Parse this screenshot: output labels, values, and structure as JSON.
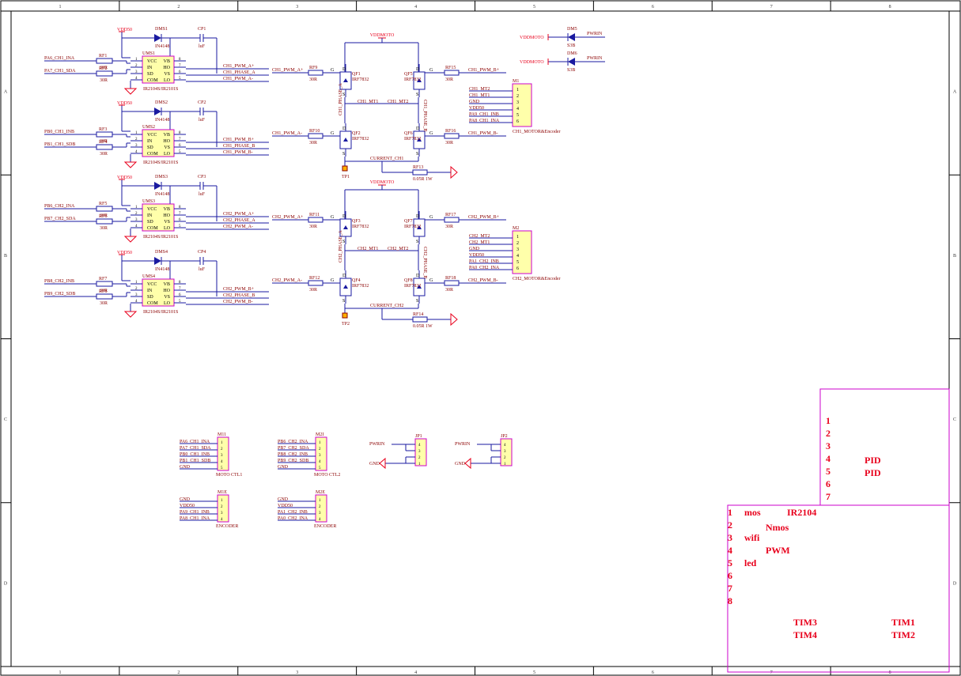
{
  "frame": {
    "columns": [
      "1",
      "2",
      "3",
      "4",
      "5",
      "6",
      "7",
      "8"
    ],
    "rows": [
      "A",
      "B",
      "C",
      "D"
    ]
  },
  "colors": {
    "wire": "#1a1aa0",
    "part": "#8b0000",
    "power": "#e8001c",
    "chip": "#cc00cc",
    "body": "#ffffaa"
  },
  "drivers": [
    {
      "vdd": "VDD50",
      "diode": "DMS1",
      "diode_val": "IN4148",
      "cap": "CP1",
      "cap_val": "luF",
      "chip": "UMS1",
      "part": "IR2104S/IR2101S",
      "r1": "RF1",
      "r2": "RF2",
      "rval": "30R",
      "in1": "PA6_CH1_INA",
      "in2": "PA7_CH1_SDA",
      "out": [
        "CH1_PWM_A+",
        "CH1_PHASE_A",
        "CH1_PWM_A-"
      ]
    },
    {
      "vdd": "VDD50",
      "diode": "DMS2",
      "diode_val": "IN4148",
      "cap": "CP2",
      "cap_val": "luF",
      "chip": "UMS2",
      "part": "IR2104S/IR2101S",
      "r1": "RF3",
      "r2": "RF4",
      "rval": "30R",
      "in1": "PB0_CH1_INB",
      "in2": "PB1_CH1_SDB",
      "out": [
        "CH1_PWM_B+",
        "CH1_PHASE_B",
        "CH1_PWM_B-"
      ]
    },
    {
      "vdd": "VDD50",
      "diode": "DMS3",
      "diode_val": "IN4148",
      "cap": "CP3",
      "cap_val": "luF",
      "chip": "UMS3",
      "part": "IR2104S/IR2101S",
      "r1": "RF5",
      "r2": "RF6",
      "rval": "30R",
      "in1": "PB6_CH2_INA",
      "in2": "PB7_CH2_SDA",
      "out": [
        "CH2_PWM_A+",
        "CH2_PHASE_A",
        "CH2_PWM_A-"
      ]
    },
    {
      "vdd": "VDD50",
      "diode": "DMS4",
      "diode_val": "IN4148",
      "cap": "CP4",
      "cap_val": "luF",
      "chip": "UMS4",
      "part": "IR2104S/IR2101S",
      "r1": "RF7",
      "r2": "RF8",
      "rval": "30R",
      "in1": "PB8_CH2_INB",
      "in2": "PB9_CH2_SDB",
      "out": [
        "CH2_PWM_B+",
        "CH2_PHASE_B",
        "CH2_PWM_B-"
      ]
    }
  ],
  "chip_pins": {
    "left": [
      "VCC",
      "IN",
      "SD",
      "COM"
    ],
    "right": [
      "VB",
      "HO",
      "VS",
      "LO"
    ],
    "lnum": [
      "1",
      "2",
      "3",
      "4"
    ],
    "rnum": [
      "8",
      "7",
      "6",
      "5"
    ]
  },
  "bridges": [
    {
      "vdd": "VDDMOTO",
      "q": [
        "QF1",
        "QF2",
        "QF5",
        "QF6"
      ],
      "qpart": "IRF7832",
      "r": [
        "RF9",
        "RF10",
        "RF15",
        "RF16"
      ],
      "rval": "30R",
      "g": [
        "CH1_PWM_A+",
        "CH1_PWM_A-",
        "CH1_PWM_B+",
        "CH1_PWM_B-"
      ],
      "mt": [
        "CH1_MT1",
        "CH1_MT2"
      ],
      "ph": [
        "CH1_PHASE_A",
        "CH1_PHASE_B"
      ],
      "cur": "CURRENT_CH1",
      "rs": "RF13",
      "rsval": "0.05R 1W",
      "tp": "TP1"
    },
    {
      "vdd": "VDDMOTO",
      "q": [
        "QF3",
        "QF4",
        "QF7",
        "QF8"
      ],
      "qpart": "IRF7832",
      "r": [
        "RF11",
        "RF12",
        "RF17",
        "RF18"
      ],
      "rval": "30R",
      "g": [
        "CH2_PWM_A+",
        "CH2_PWM_A-",
        "CH2_PWM_B+",
        "CH2_PWM_B-"
      ],
      "mt": [
        "CH2_MT1",
        "CH2_MT2"
      ],
      "ph": [
        "CH2_PHASE_A",
        "CH2_PHASE_B"
      ],
      "cur": "CURRENT_CH2",
      "rs": "RF14",
      "rsval": "0.05R 1W",
      "tp": "TP2"
    }
  ],
  "motor_connectors": [
    {
      "ref": "M1",
      "name": "CH1_MOTOR&Encoder",
      "nets": [
        "CH1_MT2",
        "CH1_MT1",
        "GND",
        "VDD50",
        "PA9_CH1_INB",
        "PA8_CH1_INA"
      ]
    },
    {
      "ref": "M2",
      "name": "CH2_MOTOR&Encoder",
      "nets": [
        "CH2_MT2",
        "CH2_MT1",
        "GND",
        "VDD50",
        "PA1_CH2_INB",
        "PA0_CH2_INA"
      ]
    }
  ],
  "power_diodes": [
    {
      "ref": "DM5",
      "val": "S3B",
      "in": "VDDMOTO",
      "out": "PWRIN"
    },
    {
      "ref": "DM6",
      "val": "S3B",
      "in": "VDDMOTO",
      "out": "PWRIN"
    }
  ],
  "small_connectors": [
    {
      "ref": "M11",
      "name": "MOTO CTL1",
      "nets": [
        "PA6_CH1_INA",
        "PA7_CH1_SDA",
        "PB0_CH1_INB",
        "PB1_CH1_SDB",
        "GND"
      ]
    },
    {
      "ref": "M2I",
      "name": "MOTO CTL2",
      "nets": [
        "PB6_CH2_INA",
        "PB7_CH2_SDA",
        "PB8_CH2_INB",
        "PB9_CH2_SDB",
        "GND"
      ]
    },
    {
      "ref": "M1E",
      "name": "ENCODER",
      "nets": [
        "GND",
        "VDD50",
        "PA9_CH1_INB",
        "PA8_CH1_INA"
      ]
    },
    {
      "ref": "M2E",
      "name": "ENCODER",
      "nets": [
        "GND",
        "VDD50",
        "PA1_CH2_INB",
        "PA0_CH2_INA"
      ]
    }
  ],
  "jumpers": [
    {
      "ref": "JP1",
      "pwr": "PWRIN",
      "gnd": "GND",
      "pins": [
        "4",
        "3",
        "2",
        "1"
      ]
    },
    {
      "ref": "JP2",
      "pwr": "PWRIN",
      "gnd": "GND",
      "pins": [
        "4",
        "3",
        "2",
        "1"
      ]
    }
  ],
  "notes_top": {
    "nums": [
      "1",
      "2",
      "3",
      "4",
      "5",
      "6",
      "7"
    ],
    "texts": [
      "",
      "",
      "",
      "PID",
      "PID",
      "",
      ""
    ]
  },
  "notes_bottom": {
    "nums": [
      "1",
      "2",
      "3",
      "4",
      "5",
      "6",
      "7",
      "8"
    ],
    "left": [
      "mos",
      "",
      "wifi",
      "",
      "led",
      "",
      "",
      ""
    ],
    "mid": [
      "IR2104",
      "Nmos",
      "",
      "PWM",
      "",
      "",
      "",
      ""
    ],
    "tim": [
      "TIM3",
      "TIM4",
      "TIM1",
      "TIM2"
    ]
  }
}
